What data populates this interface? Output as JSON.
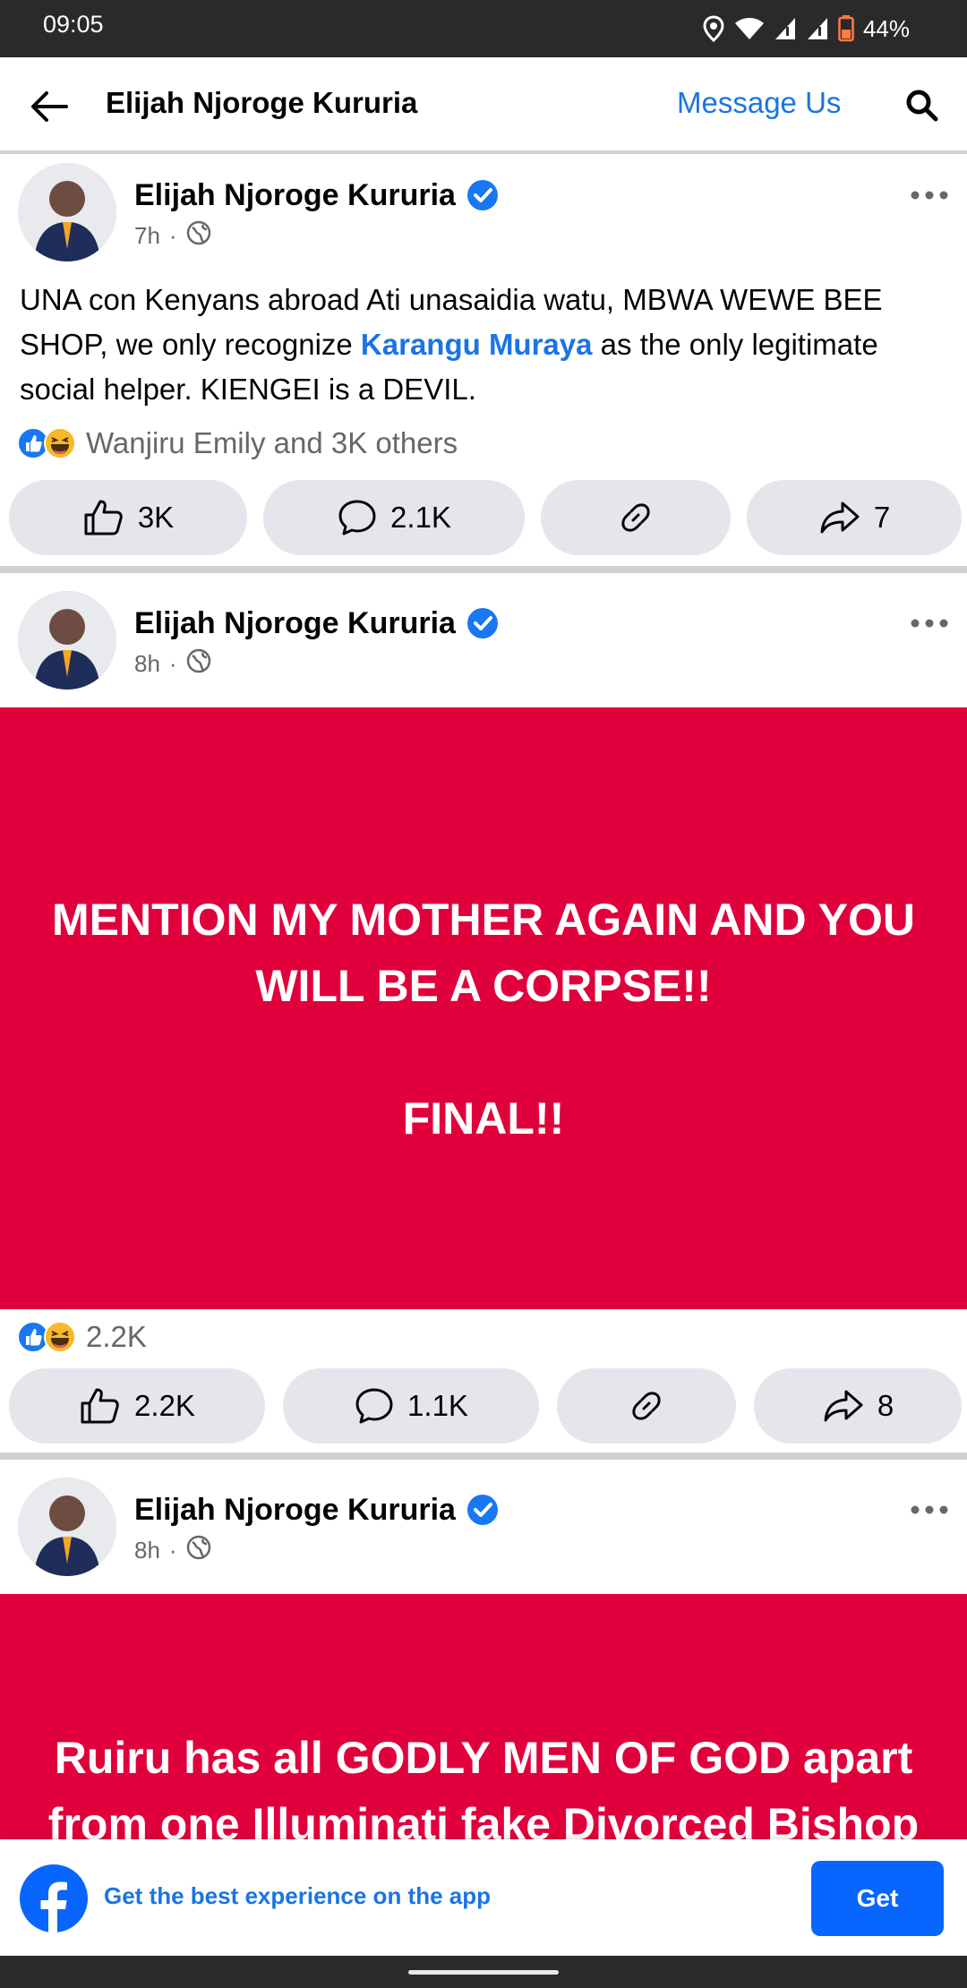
{
  "status_bar": {
    "time": "09:05",
    "battery": "44%",
    "icons": [
      "location-icon",
      "wifi-icon",
      "signal-icon",
      "signal-icon",
      "battery-icon"
    ]
  },
  "header": {
    "title": "Elijah Njoroge Kururia",
    "message_us": "Message Us",
    "back_icon": "back-arrow-icon",
    "search_icon": "search-icon"
  },
  "posts": [
    {
      "author": "Elijah Njoroge Kururia",
      "time": "7h",
      "separator": "·",
      "text_before": "UNA con Kenyans abroad Ati unasaidia watu, MBWA WEWE BEE SHOP, we only recognize ",
      "mention": "Karangu Muraya",
      "text_after": " as the only legitimate social helper. KIENGEI is a DEVIL.",
      "reactions_summary": "Wanjiru Emily and 3K others",
      "likes": "3K",
      "comments": "2.1K",
      "shares": "7"
    },
    {
      "author": "Elijah Njoroge Kururia",
      "time": "8h",
      "separator": "·",
      "card_line1": "MENTION MY MOTHER AGAIN AND YOU",
      "card_line2": "WILL BE A CORPSE!!",
      "card_line3": "FINAL!!",
      "reactions_summary": "2.2K",
      "likes": "2.2K",
      "comments": "1.1K",
      "shares": "8"
    },
    {
      "author": "Elijah Njoroge Kururia",
      "time": "8h",
      "separator": "·",
      "card_line1": "Ruiru has all GODLY MEN OF GOD apart",
      "card_line2": "from one Illuminati fake Divorced Bishop"
    }
  ],
  "banner": {
    "text": "Get the best experience on the app",
    "button": "Get"
  },
  "colors": {
    "accent": "#1b74e4",
    "card_red": "#e0003c",
    "button_blue": "#0866ff",
    "pill_gray": "#e4e6eb"
  }
}
